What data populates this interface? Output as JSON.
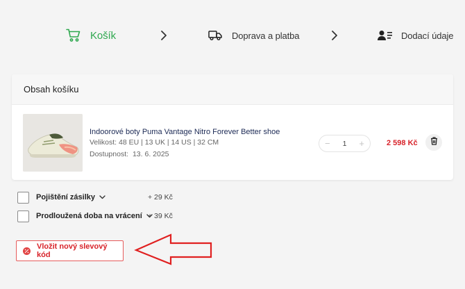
{
  "stepper": {
    "steps": [
      {
        "label": "Košík",
        "icon": "cart-icon",
        "active": true
      },
      {
        "label": "Doprava a platba",
        "icon": "truck-icon",
        "active": false
      },
      {
        "label": "Dodací údaje",
        "icon": "user-details-icon",
        "active": false
      }
    ],
    "separator_icon": "chevron-right-icon",
    "active_color": "#2fa84f"
  },
  "cart": {
    "title": "Obsah košíku",
    "items": [
      {
        "name": "Indoorové boty Puma Vantage Nitro Forever Better shoe",
        "size": "Velikost: 48 EU | 13 UK | 14 US | 32 CM",
        "availability_label": "Dostupnost:",
        "availability_date": "13. 6. 2025",
        "quantity": "1",
        "minus": "−",
        "plus": "+",
        "price": "2 598 Kč",
        "price_color": "#d8232a",
        "delete_icon": "trash-icon"
      }
    ]
  },
  "options": [
    {
      "label": "Pojištění zásilky",
      "price": "+ 29 Kč"
    },
    {
      "label": "Prodloužená doba na vrácení",
      "price": "+ 39 Kč"
    }
  ],
  "discount": {
    "label": "Vložit nový slevový kód",
    "icon": "percent-badge-icon",
    "color": "#d8232a"
  },
  "annotation": {
    "icon": "red-arrow-annotation",
    "color": "#e02020"
  }
}
